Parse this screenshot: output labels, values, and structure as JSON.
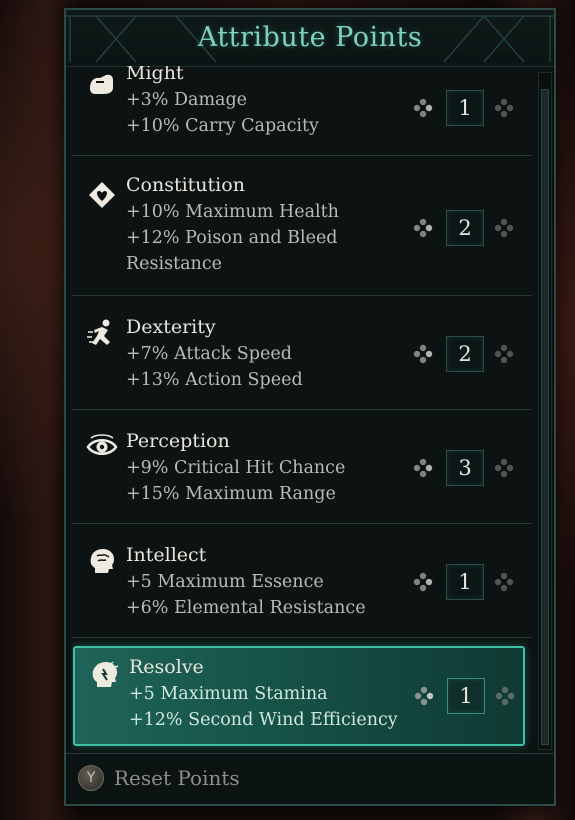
{
  "panel": {
    "title": "Attribute Points",
    "attributes": [
      {
        "name": "Might",
        "icon": "might-fist-icon",
        "lines": [
          "+3% Damage",
          "+10% Carry Capacity"
        ],
        "value": "1",
        "selected": false
      },
      {
        "name": "Constitution",
        "icon": "constitution-heart-icon",
        "lines": [
          "+10% Maximum Health",
          "+12% Poison and Bleed",
          "Resistance"
        ],
        "value": "2",
        "selected": false
      },
      {
        "name": "Dexterity",
        "icon": "dexterity-runner-icon",
        "lines": [
          "+7% Attack Speed",
          "+13% Action Speed"
        ],
        "value": "2",
        "selected": false
      },
      {
        "name": "Perception",
        "icon": "perception-eye-icon",
        "lines": [
          "+9% Critical Hit Chance",
          "+15% Maximum Range"
        ],
        "value": "3",
        "selected": false
      },
      {
        "name": "Intellect",
        "icon": "intellect-brain-icon",
        "lines": [
          "+5 Maximum Essence",
          "+6% Elemental Resistance"
        ],
        "value": "1",
        "selected": false
      },
      {
        "name": "Resolve",
        "icon": "resolve-head-icon",
        "lines": [
          "+5 Maximum Stamina",
          "+12% Second Wind Efficiency"
        ],
        "value": "1",
        "selected": true
      }
    ]
  },
  "footer": {
    "button_glyph": "Y",
    "reset_label": "Reset Points"
  },
  "colors": {
    "accent": "#7ed3bf",
    "selected_fill": "#1f6458",
    "selected_border": "#3fbfa5",
    "panel_bg": "#0d1212"
  }
}
